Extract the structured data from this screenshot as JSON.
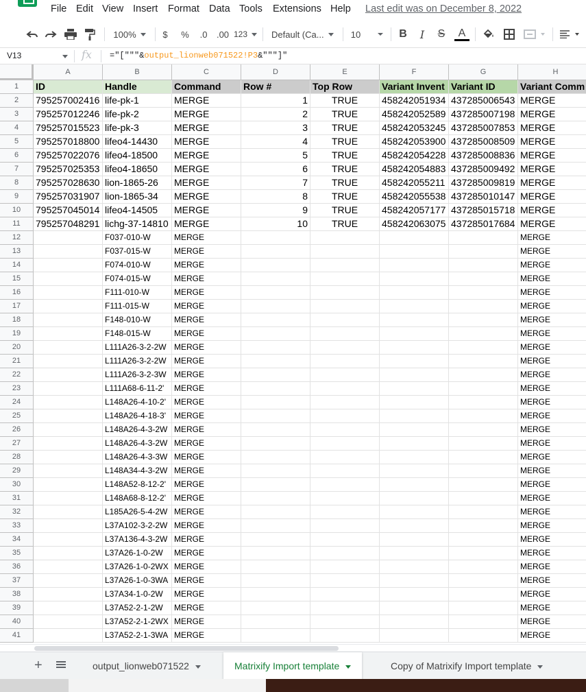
{
  "menu": {
    "items": [
      "File",
      "Edit",
      "View",
      "Insert",
      "Format",
      "Data",
      "Tools",
      "Extensions",
      "Help"
    ],
    "last_edit": "Last edit was on December 8, 2022"
  },
  "toolbar": {
    "zoom": "100%",
    "currency": "$",
    "percent": "%",
    "decrease_decimals": ".0",
    "increase_decimals": ".00",
    "more_formats": "123",
    "font": "Default (Ca...",
    "font_size": "10",
    "bold": "B",
    "italic": "I",
    "strike": "S",
    "text_color": "A"
  },
  "formula_bar": {
    "cell_ref": "V13",
    "fx": "fx",
    "formula_prefix": "=\"[\"\"\"&",
    "formula_ref": "output_lionweb071522!P3",
    "formula_suffix": "&\"\"\"]\""
  },
  "sheet": {
    "columns": [
      {
        "letter": "A",
        "header": "ID",
        "header_bg": "#d9ead3"
      },
      {
        "letter": "B",
        "header": "Handle",
        "header_bg": "#d9ead3"
      },
      {
        "letter": "C",
        "header": "Command",
        "header_bg": "#cccccc"
      },
      {
        "letter": "D",
        "header": "Row #",
        "header_bg": "#cccccc"
      },
      {
        "letter": "E",
        "header": "Top Row",
        "header_bg": "#cccccc"
      },
      {
        "letter": "F",
        "header": "Variant Invent",
        "header_bg": "#b6d7a8"
      },
      {
        "letter": "G",
        "header": "Variant ID",
        "header_bg": "#b6d7a8"
      },
      {
        "letter": "H",
        "header": "Variant Comm",
        "header_bg": "#cccccc"
      }
    ],
    "data_rows": [
      {
        "id": "795257002416",
        "handle": "life-pk-1",
        "command": "MERGE",
        "row_num": "1",
        "top_row": "TRUE",
        "variant_inventory": "458242051934",
        "variant_id": "437285006543",
        "variant_command": "MERGE"
      },
      {
        "id": "795257012246",
        "handle": "life-pk-2",
        "command": "MERGE",
        "row_num": "2",
        "top_row": "TRUE",
        "variant_inventory": "458242052589",
        "variant_id": "437285007198",
        "variant_command": "MERGE"
      },
      {
        "id": "795257015523",
        "handle": "life-pk-3",
        "command": "MERGE",
        "row_num": "3",
        "top_row": "TRUE",
        "variant_inventory": "458242053245",
        "variant_id": "437285007853",
        "variant_command": "MERGE"
      },
      {
        "id": "795257018800",
        "handle": "lifeo4-14430",
        "command": "MERGE",
        "row_num": "4",
        "top_row": "TRUE",
        "variant_inventory": "458242053900",
        "variant_id": "437285008509",
        "variant_command": "MERGE"
      },
      {
        "id": "795257022076",
        "handle": "lifeo4-18500",
        "command": "MERGE",
        "row_num": "5",
        "top_row": "TRUE",
        "variant_inventory": "458242054228",
        "variant_id": "437285008836",
        "variant_command": "MERGE"
      },
      {
        "id": "795257025353",
        "handle": "lifeo4-18650",
        "command": "MERGE",
        "row_num": "6",
        "top_row": "TRUE",
        "variant_inventory": "458242054883",
        "variant_id": "437285009492",
        "variant_command": "MERGE"
      },
      {
        "id": "795257028630",
        "handle": "lion-1865-26",
        "command": "MERGE",
        "row_num": "7",
        "top_row": "TRUE",
        "variant_inventory": "458242055211",
        "variant_id": "437285009819",
        "variant_command": "MERGE"
      },
      {
        "id": "795257031907",
        "handle": "lion-1865-34",
        "command": "MERGE",
        "row_num": "8",
        "top_row": "TRUE",
        "variant_inventory": "458242055538",
        "variant_id": "437285010147",
        "variant_command": "MERGE"
      },
      {
        "id": "795257045014",
        "handle": "lifeo4-14505",
        "command": "MERGE",
        "row_num": "9",
        "top_row": "TRUE",
        "variant_inventory": "458242057177",
        "variant_id": "437285015718",
        "variant_command": "MERGE"
      },
      {
        "id": "795257048291",
        "handle": "lichg-37-14810",
        "command": "MERGE",
        "row_num": "10",
        "top_row": "TRUE",
        "variant_inventory": "458242063075",
        "variant_id": "437285017684",
        "variant_command": "MERGE"
      }
    ],
    "variant_rows": [
      {
        "handle": "F037-010-W",
        "command": "MERGE",
        "variant_command": "MERGE"
      },
      {
        "handle": "F037-015-W",
        "command": "MERGE",
        "variant_command": "MERGE"
      },
      {
        "handle": "F074-010-W",
        "command": "MERGE",
        "variant_command": "MERGE"
      },
      {
        "handle": "F074-015-W",
        "command": "MERGE",
        "variant_command": "MERGE"
      },
      {
        "handle": "F111-010-W",
        "command": "MERGE",
        "variant_command": "MERGE"
      },
      {
        "handle": "F111-015-W",
        "command": "MERGE",
        "variant_command": "MERGE"
      },
      {
        "handle": "F148-010-W",
        "command": "MERGE",
        "variant_command": "MERGE"
      },
      {
        "handle": "F148-015-W",
        "command": "MERGE",
        "variant_command": "MERGE"
      },
      {
        "handle": "L111A26-3-2-2W",
        "command": "MERGE",
        "variant_command": "MERGE"
      },
      {
        "handle": "L111A26-3-2-2W",
        "command": "MERGE",
        "variant_command": "MERGE"
      },
      {
        "handle": "L111A26-3-2-3W",
        "command": "MERGE",
        "variant_command": "MERGE"
      },
      {
        "handle": "L111A68-6-11-2'",
        "command": "MERGE",
        "variant_command": "MERGE"
      },
      {
        "handle": "L148A26-4-10-2'",
        "command": "MERGE",
        "variant_command": "MERGE"
      },
      {
        "handle": "L148A26-4-18-3'",
        "command": "MERGE",
        "variant_command": "MERGE"
      },
      {
        "handle": "L148A26-4-3-2W",
        "command": "MERGE",
        "variant_command": "MERGE"
      },
      {
        "handle": "L148A26-4-3-2W",
        "command": "MERGE",
        "variant_command": "MERGE"
      },
      {
        "handle": "L148A26-4-3-3W",
        "command": "MERGE",
        "variant_command": "MERGE"
      },
      {
        "handle": "L148A34-4-3-2W",
        "command": "MERGE",
        "variant_command": "MERGE"
      },
      {
        "handle": "L148A52-8-12-2'",
        "command": "MERGE",
        "variant_command": "MERGE"
      },
      {
        "handle": "L148A68-8-12-2'",
        "command": "MERGE",
        "variant_command": "MERGE"
      },
      {
        "handle": "L185A26-5-4-2W",
        "command": "MERGE",
        "variant_command": "MERGE"
      },
      {
        "handle": "L37A102-3-2-2W",
        "command": "MERGE",
        "variant_command": "MERGE"
      },
      {
        "handle": "L37A136-4-3-2W",
        "command": "MERGE",
        "variant_command": "MERGE"
      },
      {
        "handle": "L37A26-1-0-2W",
        "command": "MERGE",
        "variant_command": "MERGE"
      },
      {
        "handle": "L37A26-1-0-2WX",
        "command": "MERGE",
        "variant_command": "MERGE"
      },
      {
        "handle": "L37A26-1-0-3WA",
        "command": "MERGE",
        "variant_command": "MERGE"
      },
      {
        "handle": "L37A34-1-0-2W",
        "command": "MERGE",
        "variant_command": "MERGE"
      },
      {
        "handle": "L37A52-2-1-2W",
        "command": "MERGE",
        "variant_command": "MERGE"
      },
      {
        "handle": "L37A52-2-1-2WX",
        "command": "MERGE",
        "variant_command": "MERGE"
      },
      {
        "handle": "L37A52-2-1-3WA",
        "command": "MERGE",
        "variant_command": "MERGE"
      }
    ],
    "row_numbers": [
      "1",
      "2",
      "3",
      "4",
      "5",
      "6",
      "7",
      "8",
      "9",
      "10",
      "11",
      "12",
      "13",
      "14",
      "15",
      "16",
      "17",
      "18",
      "19",
      "20",
      "21",
      "22",
      "23",
      "24",
      "25",
      "26",
      "27",
      "28",
      "29",
      "30",
      "31",
      "32",
      "33",
      "34",
      "35",
      "36",
      "37",
      "38",
      "39",
      "40",
      "41"
    ]
  },
  "tabs": {
    "add_label": "+",
    "sheets": [
      {
        "name": "output_lionweb071522",
        "active": false
      },
      {
        "name": "Matrixify Import template",
        "active": true
      },
      {
        "name": "Copy of Matrixify Import template",
        "active": false
      }
    ]
  },
  "colors": {
    "accent": "#188038",
    "formula_ref": "#f7981d",
    "id_handle_header": "#d9ead3",
    "variant_header": "#b6d7a8",
    "gray_header": "#cccccc"
  }
}
